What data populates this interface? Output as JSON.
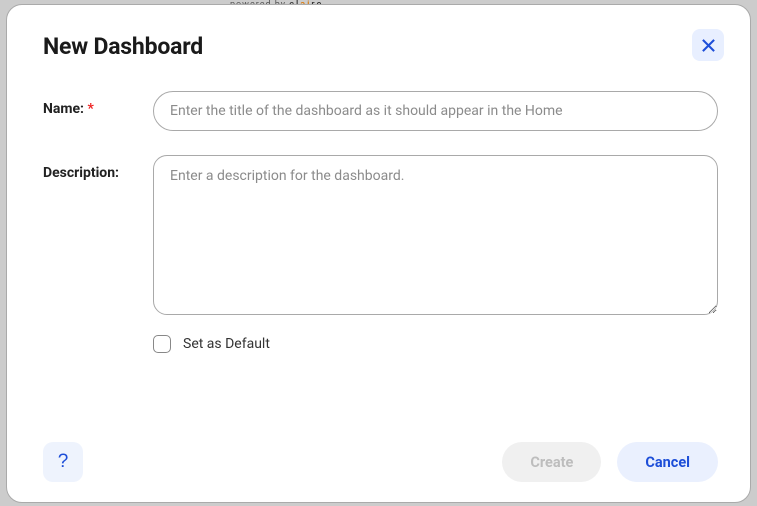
{
  "backdrop": {
    "prefix": "powered by ",
    "brand_pre": "CL",
    "brand_ai": "AI",
    "brand_post": "RE"
  },
  "modal": {
    "title": "New Dashboard",
    "close_label": "Close"
  },
  "form": {
    "name": {
      "label": "Name:",
      "required_mark": "*",
      "value": "",
      "placeholder": "Enter the title of the dashboard as it should appear in the Home"
    },
    "description": {
      "label": "Description:",
      "value": "",
      "placeholder": "Enter a description for the dashboard."
    },
    "default": {
      "label": "Set as Default",
      "checked": false
    }
  },
  "footer": {
    "help_label": "?",
    "create_label": "Create",
    "cancel_label": "Cancel"
  }
}
